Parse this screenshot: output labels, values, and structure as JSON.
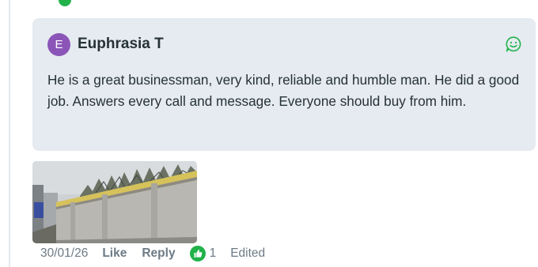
{
  "comment": {
    "avatar_initial": "E",
    "author": "Euphrasia T",
    "body": "He is a great businessman, very kind, reliable and humble man. He did a good job. Answers every call and message. Everyone should buy from him.",
    "reaction_icon": "smile-icon"
  },
  "attachment": {
    "icon": "wall-photo"
  },
  "actions": {
    "date": "30/01/26",
    "like_label": "Like",
    "reply_label": "Reply",
    "like_icon": "thumbs-up-icon",
    "like_count": "1",
    "edited_label": "Edited"
  },
  "colors": {
    "accent_green": "#21b24a",
    "card_bg": "#e5ebf0",
    "avatar_bg": "#8b55b8",
    "muted_text": "#6d7a85"
  }
}
